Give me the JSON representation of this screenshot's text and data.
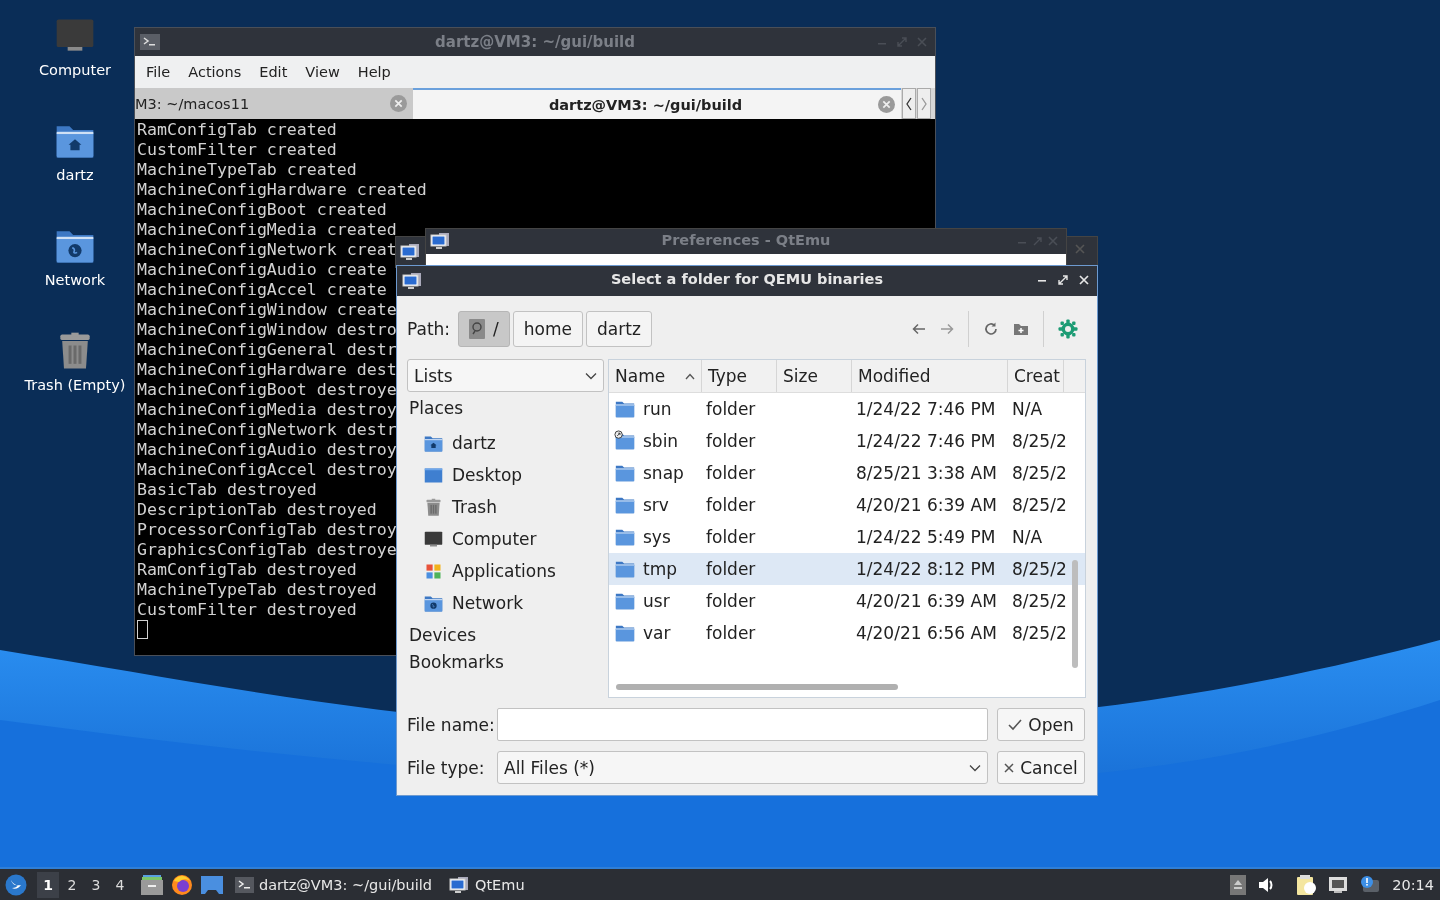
{
  "desktop_icons": [
    {
      "label": "Computer",
      "kind": "computer"
    },
    {
      "label": "dartz",
      "kind": "home"
    },
    {
      "label": "Network",
      "kind": "network"
    },
    {
      "label": "Trash (Empty)",
      "kind": "trash"
    }
  ],
  "terminal": {
    "title": "dartz@VM3: ~/gui/build",
    "menu": [
      "File",
      "Actions",
      "Edit",
      "View",
      "Help"
    ],
    "tabs": [
      {
        "label": "M3: ~/macos11",
        "selected": false
      },
      {
        "label": "dartz@VM3: ~/gui/build",
        "selected": true
      }
    ],
    "lines": [
      "RamConfigTab created",
      "CustomFilter created",
      "MachineTypeTab created",
      "MachineConfigHardware created",
      "MachineConfigBoot created",
      "MachineConfigMedia created",
      "MachineConfigNetwork creat",
      "MachineConfigAudio create",
      "MachineConfigAccel create",
      "MachineConfigWindow create",
      "MachineConfigWindow destro",
      "MachineConfigGeneral destr",
      "MachineConfigHardware dest",
      "MachineConfigBoot destroye",
      "MachineConfigMedia destroy",
      "MachineConfigNetwork destr",
      "MachineConfigAudio destroy",
      "MachineConfigAccel destroy",
      "BasicTab destroyed",
      "DescriptionTab destroyed",
      "ProcessorConfigTab destroy",
      "GraphicsConfigTab destroye",
      "RamConfigTab destroyed",
      "MachineTypeTab destroyed",
      "CustomFilter destroyed"
    ]
  },
  "preferences_window": {
    "title": "Preferences - QtEmu"
  },
  "dialog": {
    "title": "Select a folder for QEMU binaries",
    "path_label": "Path:",
    "crumbs": [
      {
        "label": "/",
        "kind": "root",
        "selected": true
      },
      {
        "label": "home",
        "kind": "dir",
        "selected": false
      },
      {
        "label": "dartz",
        "kind": "dir",
        "selected": false
      }
    ],
    "view_combo": "Lists",
    "sidebar": [
      {
        "label": "Places",
        "items": [
          {
            "label": "dartz",
            "kind": "home"
          },
          {
            "label": "Desktop",
            "kind": "desktop"
          },
          {
            "label": "Trash",
            "kind": "trash"
          },
          {
            "label": "Computer",
            "kind": "computer"
          },
          {
            "label": "Applications",
            "kind": "applications"
          },
          {
            "label": "Network",
            "kind": "network"
          }
        ]
      },
      {
        "label": "Devices"
      },
      {
        "label": "Bookmarks"
      }
    ],
    "columns": [
      {
        "label": "Name",
        "sorted": true
      },
      {
        "label": "Type",
        "sorted": false
      },
      {
        "label": "Size",
        "sorted": false
      },
      {
        "label": "Modified",
        "sorted": false
      },
      {
        "label": "Creat",
        "sorted": false
      }
    ],
    "rows": [
      {
        "name": "run",
        "kind": "folder",
        "type": "folder",
        "modified": "1/24/22 7:46 PM",
        "created": "N/A",
        "selected": false
      },
      {
        "name": "sbin",
        "kind": "link",
        "type": "folder",
        "modified": "1/24/22 7:46 PM",
        "created": "8/25/2",
        "selected": false
      },
      {
        "name": "snap",
        "kind": "folder",
        "type": "folder",
        "modified": "8/25/21 3:38 AM",
        "created": "8/25/2",
        "selected": false
      },
      {
        "name": "srv",
        "kind": "folder",
        "type": "folder",
        "modified": "4/20/21 6:39 AM",
        "created": "8/25/2",
        "selected": false
      },
      {
        "name": "sys",
        "kind": "folder",
        "type": "folder",
        "modified": "1/24/22 5:49 PM",
        "created": "N/A",
        "selected": false
      },
      {
        "name": "tmp",
        "kind": "folder",
        "type": "folder",
        "modified": "1/24/22 8:12 PM",
        "created": "8/25/2",
        "selected": true
      },
      {
        "name": "usr",
        "kind": "folder",
        "type": "folder",
        "modified": "4/20/21 6:39 AM",
        "created": "8/25/2",
        "selected": false
      },
      {
        "name": "var",
        "kind": "folder",
        "type": "folder",
        "modified": "4/20/21 6:56 AM",
        "created": "8/25/2",
        "selected": false
      }
    ],
    "file_name": {
      "label": "File name:"
    },
    "file_type": {
      "label": "File type:",
      "value": "All Files (*)"
    },
    "buttons": [
      {
        "label": "Open",
        "kind": "ok"
      },
      {
        "label": "Cancel",
        "kind": "cancel"
      }
    ]
  },
  "taskbar": {
    "workspaces": [
      {
        "label": "1",
        "selected": true
      },
      {
        "label": "2",
        "selected": false
      },
      {
        "label": "3",
        "selected": false
      },
      {
        "label": "4",
        "selected": false
      }
    ],
    "tasks": [
      {
        "label": "dartz@VM3: ~/gui/build",
        "kind": "terminal"
      },
      {
        "label": "QtEmu",
        "kind": "qtemu"
      }
    ],
    "clock": "20:14"
  }
}
